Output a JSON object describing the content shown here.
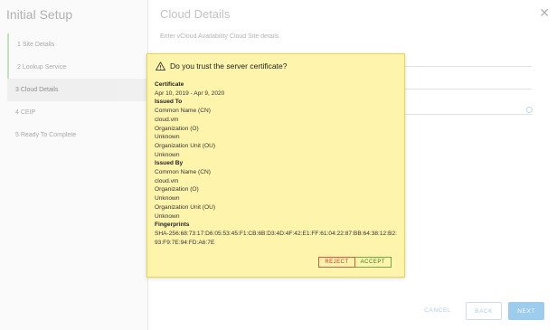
{
  "wizard": {
    "title": "Initial Setup",
    "steps": [
      {
        "label": "1  Site Details"
      },
      {
        "label": "2  Lookup Service"
      },
      {
        "label": "3  Cloud Details"
      },
      {
        "label": "4  CEIP"
      },
      {
        "label": "5  Ready To Complete"
      }
    ],
    "active_step": 3
  },
  "page": {
    "title": "Cloud Details",
    "subtitle": "Enter vCloud Availability Cloud Site details.",
    "close_icon": "close-icon"
  },
  "footer": {
    "cancel_label": "CANCEL",
    "back_label": "BACK",
    "next_label": "NEXT"
  },
  "dialog": {
    "icon": "warning-icon",
    "title": "Do you trust the server certificate?",
    "lines": [
      {
        "text": "Certificate",
        "heading": true
      },
      {
        "text": "Apr 10, 2019 - Apr 9, 2020"
      },
      {
        "text": "Issued To",
        "heading": true
      },
      {
        "text": "Common Name (CN)"
      },
      {
        "text": "cloud.vm"
      },
      {
        "text": "Organization (O)"
      },
      {
        "text": "Unknown"
      },
      {
        "text": "Organization Unit (OU)"
      },
      {
        "text": "Unknown"
      },
      {
        "text": "Issued By",
        "heading": true
      },
      {
        "text": "Common Name (CN)"
      },
      {
        "text": "cloud.vm"
      },
      {
        "text": "Organization (O)"
      },
      {
        "text": "Unknown"
      },
      {
        "text": "Organization Unit (OU)"
      },
      {
        "text": "Unknown"
      },
      {
        "text": "Fingerprints",
        "heading": true
      },
      {
        "text": "SHA-256:68:73:17:D6:05:53:45:F1:CB:6B:D3:4D:4F:42:E1:FF:61:04:22:87:BB:64:38:12:B2:93:F9:7E:94:FD:A6:7E",
        "fingerprint": true
      }
    ],
    "reject_label": "REJECT",
    "accept_label": "ACCEPT"
  },
  "colors": {
    "dialog_bg": "#fff4ac",
    "dialog_border": "#e7d44f",
    "reject": "#c0392b",
    "accept": "#3c7a2a",
    "primary": "#8cc2ea"
  }
}
